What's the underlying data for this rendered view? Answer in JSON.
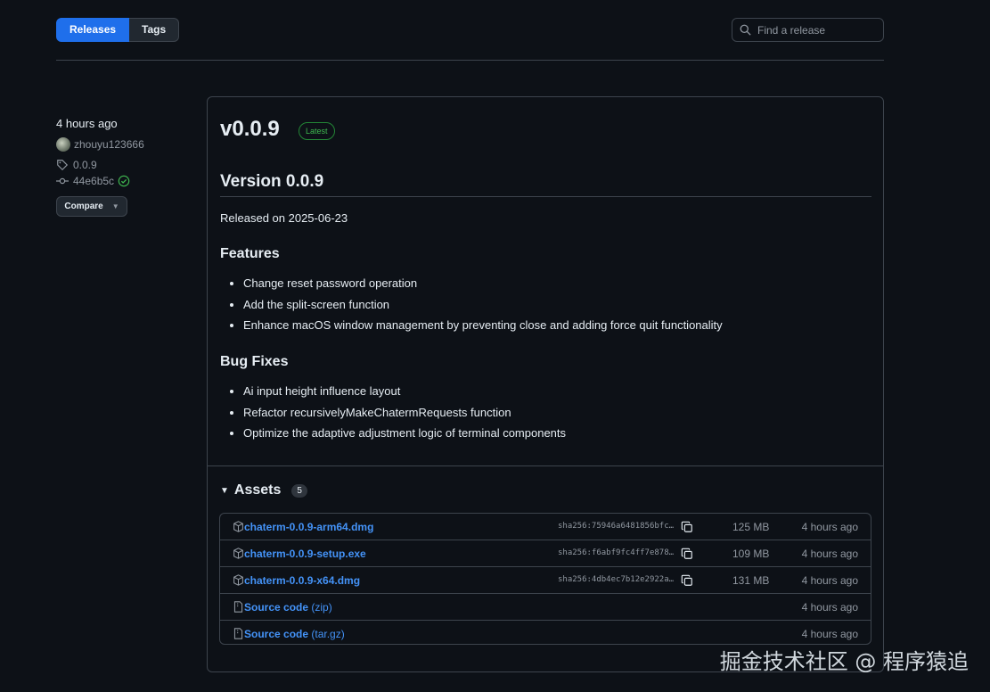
{
  "nav": {
    "releases_label": "Releases",
    "tags_label": "Tags",
    "search_placeholder": "Find a release"
  },
  "sidebar": {
    "time": "4 hours ago",
    "author": "zhouyu123666",
    "tag": "0.0.9",
    "commit": "44e6b5c",
    "compare_label": "Compare"
  },
  "release": {
    "title": "v0.0.9",
    "badge": "Latest",
    "heading": "Version 0.0.9",
    "released_on": "Released on 2025-06-23",
    "features_heading": "Features",
    "features": [
      "Change reset password operation",
      "Add the split-screen function",
      "Enhance macOS window management by preventing close and adding force quit functionality"
    ],
    "bugfix_heading": "Bug Fixes",
    "bugfixes": [
      "Ai input height influence layout",
      "Refactor recursivelyMakeChatermRequests function",
      "Optimize the adaptive adjustment logic of terminal components"
    ]
  },
  "assets": {
    "label": "Assets",
    "count": "5",
    "items": [
      {
        "name": "chaterm-0.0.9-arm64.dmg",
        "sha": "sha256:75946a6481856bfc…",
        "size": "125 MB",
        "time": "4 hours ago"
      },
      {
        "name": "chaterm-0.0.9-setup.exe",
        "sha": "sha256:f6abf9fc4ff7e878…",
        "size": "109 MB",
        "time": "4 hours ago"
      },
      {
        "name": "chaterm-0.0.9-x64.dmg",
        "sha": "sha256:4db4ec7b12e2922a…",
        "size": "131 MB",
        "time": "4 hours ago"
      },
      {
        "name": "Source code",
        "suffix": " (zip)",
        "time": "4 hours ago"
      },
      {
        "name": "Source code",
        "suffix": " (tar.gz)",
        "time": "4 hours ago"
      }
    ]
  },
  "watermark": "掘金技术社区 @ 程序猿追",
  "colors": {
    "accent": "#1f6feb",
    "link": "#4493f8",
    "success": "#3fb950",
    "background": "#0d1117"
  }
}
